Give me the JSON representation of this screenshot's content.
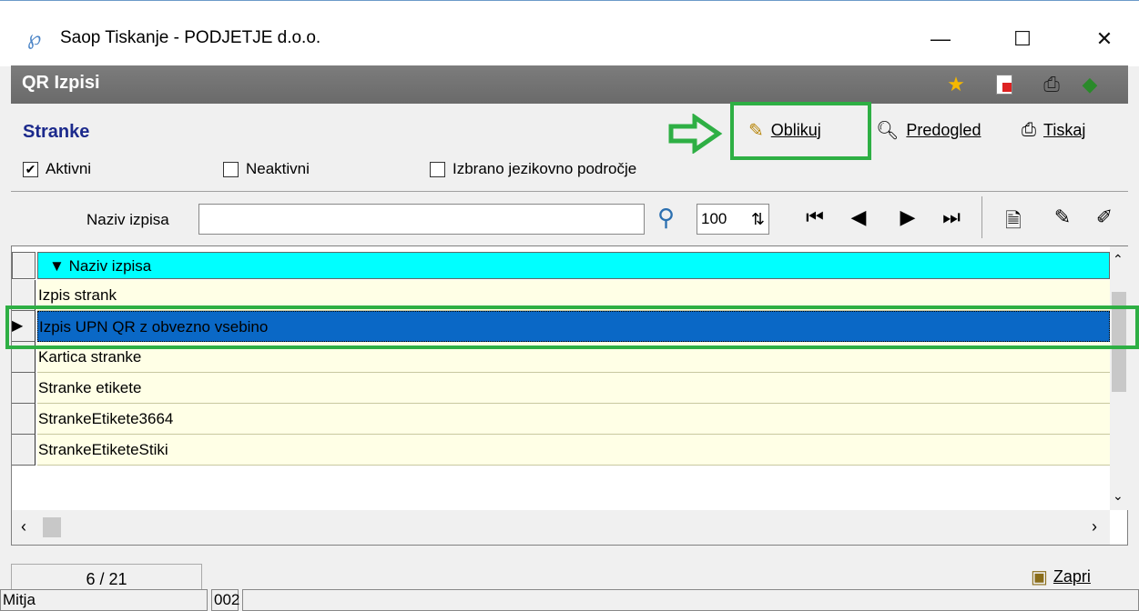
{
  "window": {
    "title": "Saop Tiskanje - PODJETJE d.o.o.",
    "minimize": "—",
    "maximize": "☐",
    "close": "✕"
  },
  "header": {
    "title": "QR Izpisi"
  },
  "panel": {
    "heading": "Stranke"
  },
  "filters": {
    "aktivni": "Aktivni",
    "aktivni_checked": "✔",
    "neaktivni": "Neaktivni",
    "jezik": "Izbrano jezikovno področje"
  },
  "toolbar": {
    "oblikuj": "Oblikuj",
    "predogled": "Predogled",
    "tiskaj": "Tiskaj"
  },
  "search": {
    "label": "Naziv izpisa",
    "value": "",
    "page_size": "100"
  },
  "grid": {
    "column": "Naziv izpisa",
    "rows": [
      "Izpis strank",
      "Izpis UPN QR z obvezno vsebino",
      "Kartica stranke",
      "Stranke etikete",
      "StrankeEtikete3664",
      "StrankeEtiketeStiki"
    ],
    "selected_index": 1
  },
  "footer": {
    "counter": "6 / 21",
    "zapri": "Zapri"
  },
  "statusbar": {
    "user": "Mitja",
    "code": "002"
  },
  "colors": {
    "highlight": "#2eaf44",
    "selected_row": "#0a68c6",
    "grid_header": "#00ffff",
    "header_band": "#737373"
  }
}
